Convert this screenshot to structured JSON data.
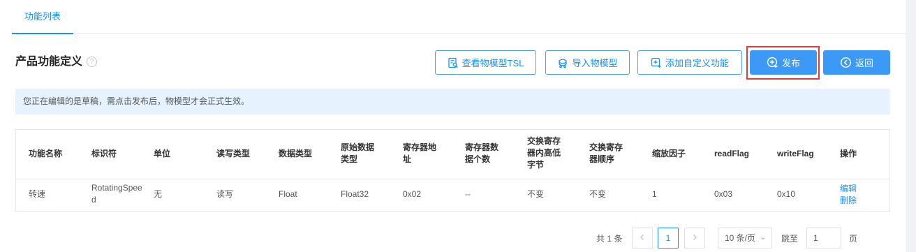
{
  "tabs": [
    {
      "label": "功能列表",
      "active": true
    }
  ],
  "header": {
    "title": "产品功能定义",
    "help_icon": "?"
  },
  "toolbar": {
    "view_tsl": "查看物模型TSL",
    "import_model": "导入物模型",
    "add_custom": "添加自定义功能",
    "publish": "发布",
    "back": "返回"
  },
  "alert": {
    "text": "您正在编辑的是草稿，需点击发布后，物模型才会正式生效。"
  },
  "table": {
    "headers": [
      "功能名称",
      "标识符",
      "单位",
      "读写类型",
      "数据类型",
      "原始数据类型",
      "寄存器地址",
      "寄存器数据个数",
      "交换寄存器内高低字节",
      "交换寄存器顺序",
      "缩放因子",
      "readFlag",
      "writeFlag",
      "操作"
    ],
    "rows": [
      {
        "name": "转速",
        "identifier": "RotatingSpeed",
        "unit": "无",
        "rw_type": "读写",
        "data_type": "Float",
        "raw_type": "Float32",
        "reg_addr": "0x02",
        "reg_count": "--",
        "swap_bytes": "不变",
        "swap_order": "不变",
        "scale": "1",
        "read_flag": "0x03",
        "write_flag": "0x10",
        "actions": [
          "编辑",
          "删除"
        ]
      }
    ]
  },
  "pagination": {
    "total": "共 1 条",
    "current_page": "1",
    "page_size": "10 条/页",
    "jump_label": "跳至",
    "jump_value": "1",
    "page_suffix": "页"
  },
  "colors": {
    "accent": "#1890ff",
    "primary_button": "#3c99f5",
    "highlight": "#e23b3b",
    "alert_bg": "#e6f2fd"
  }
}
